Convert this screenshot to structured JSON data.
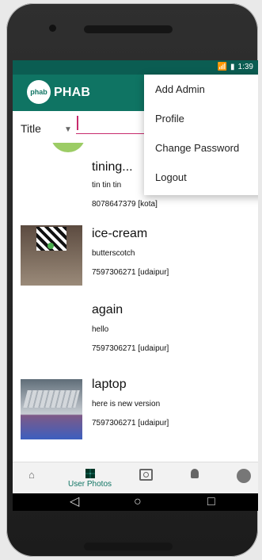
{
  "status": {
    "signal": "📶",
    "battery": "▮",
    "time": "1:39"
  },
  "app": {
    "title": "PHAB",
    "logo_text": "phab"
  },
  "filter": {
    "selected": "Title",
    "search_value": ""
  },
  "menu": [
    "Add Admin",
    "Profile",
    "Change Password",
    "Logout"
  ],
  "items": [
    {
      "title": "tining...",
      "subtitle": "tin tin tin",
      "phone": "8078647379 [kota]"
    },
    {
      "title": "ice-cream",
      "subtitle": "butterscotch",
      "phone": "7597306271 [udaipur]"
    },
    {
      "title": "again",
      "subtitle": "hello",
      "phone": "7597306271 [udaipur]"
    },
    {
      "title": "laptop",
      "subtitle": "here is new version",
      "phone": "7597306271 [udaipur]"
    }
  ],
  "bottom_nav": {
    "active_label": "User Photos"
  },
  "system_nav": {
    "back": "◁",
    "home": "○",
    "recents": "□"
  }
}
